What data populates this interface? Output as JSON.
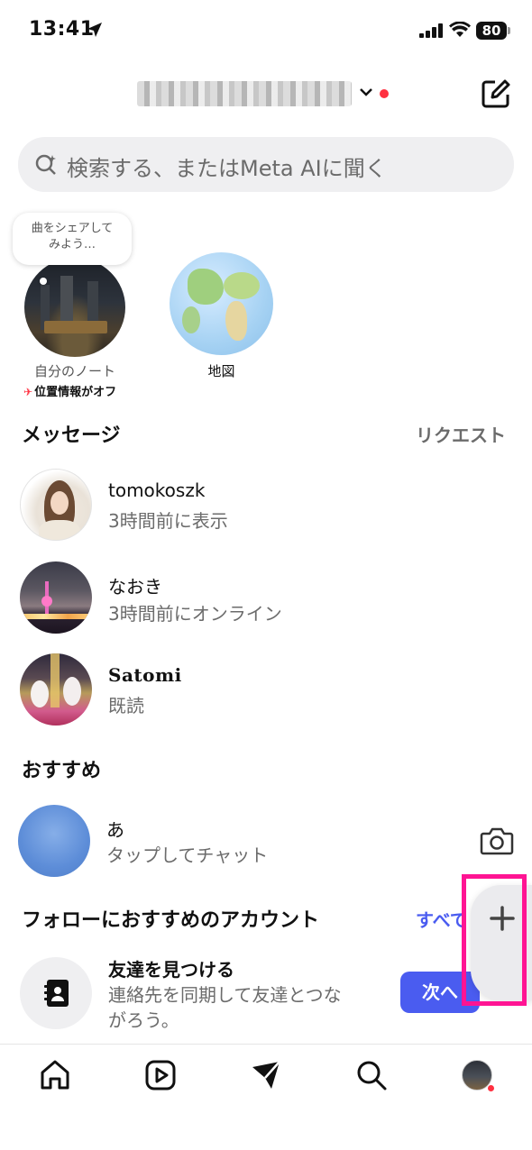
{
  "status_bar": {
    "time": "13:41",
    "battery": "80"
  },
  "header": {
    "username": "",
    "notification_color": "#ff3040"
  },
  "search": {
    "placeholder": "検索する、またはMeta AIに聞く"
  },
  "notes": {
    "bubble_text": "曲をシェアして\nみよう…",
    "my_note_label": "自分のノート",
    "location_status": "位置情報がオフ",
    "map_label": "地図"
  },
  "messages": {
    "section_title": "メッセージ",
    "requests_label": "リクエスト",
    "threads": [
      {
        "name": "tomokoszk",
        "status": "3時間前に表示"
      },
      {
        "name": "なおき",
        "status": "3時間前にオンライン"
      },
      {
        "name": "Satomi",
        "status": "既読"
      }
    ]
  },
  "suggested": {
    "section_title": "おすすめ",
    "item": {
      "name": "あ",
      "status": "タップしてチャット"
    }
  },
  "follow_suggestions": {
    "section_title": "フォローにおすすめのアカウント",
    "see_all": "すべて"
  },
  "find_friends": {
    "title": "友達を見つける",
    "description": "連絡先を同期して友達とつながろう。",
    "next_button": "次へ"
  },
  "colors": {
    "accent": "#4a5cf0",
    "highlight": "#ff1493",
    "notification": "#ff3040"
  },
  "tabbar": {
    "icons": [
      "home-icon",
      "reels-icon",
      "direct-messages-icon",
      "search-icon",
      "profile-avatar"
    ]
  }
}
